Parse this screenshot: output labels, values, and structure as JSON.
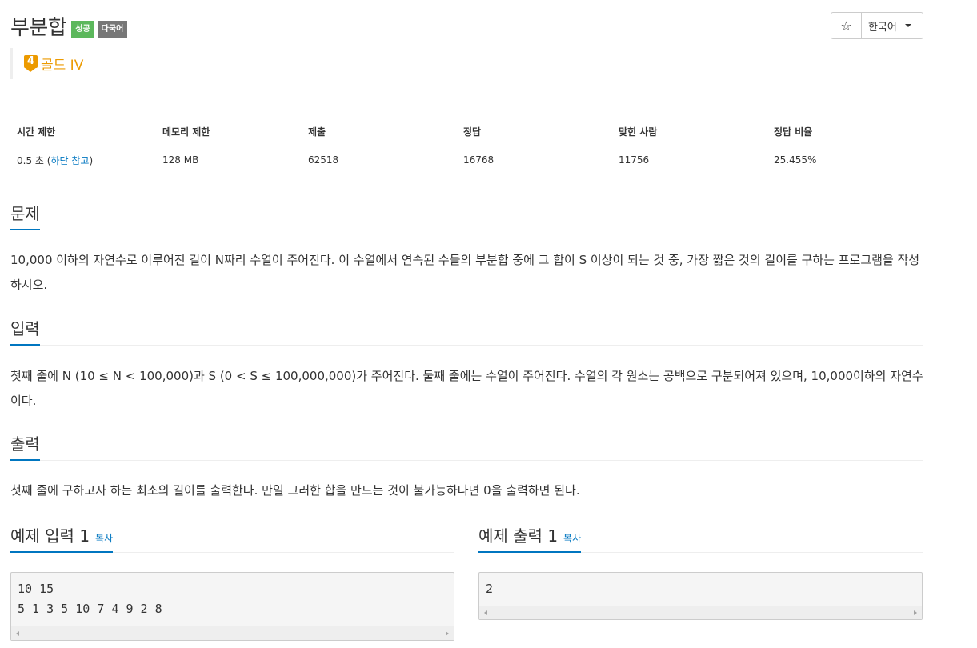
{
  "problem": {
    "title": "부분합",
    "badges": {
      "success": "성공",
      "multilang": "다국어"
    },
    "tier": {
      "number": "4",
      "label": "골드 IV",
      "color": "#ec9a00"
    }
  },
  "toolbar": {
    "star_icon": "☆",
    "language": "한국어"
  },
  "info_table": {
    "headers": [
      "시간 제한",
      "메모리 제한",
      "제출",
      "정답",
      "맞힌 사람",
      "정답 비율"
    ],
    "time_limit": "0.5 초",
    "time_note_open": " (",
    "time_note_link": "하단 참고",
    "time_note_close": ")",
    "memory_limit": "128 MB",
    "submissions": "62518",
    "accepted": "16768",
    "solvers": "11756",
    "ratio": "25.455%"
  },
  "sections": {
    "problem": {
      "title": "문제",
      "body": "10,000 이하의 자연수로 이루어진 길이 N짜리 수열이 주어진다. 이 수열에서 연속된 수들의 부분합 중에 그 합이 S 이상이 되는 것 중, 가장 짧은 것의 길이를 구하는 프로그램을 작성하시오."
    },
    "input": {
      "title": "입력",
      "body": "첫째 줄에 N (10 ≤ N < 100,000)과 S (0 < S ≤ 100,000,000)가 주어진다. 둘째 줄에는 수열이 주어진다. 수열의 각 원소는 공백으로 구분되어져 있으며, 10,000이하의 자연수이다."
    },
    "output": {
      "title": "출력",
      "body": "첫째 줄에 구하고자 하는 최소의 길이를 출력한다. 만일 그러한 합을 만드는 것이 불가능하다면 0을 출력하면 된다."
    }
  },
  "samples": {
    "copy_label": "복사",
    "input": {
      "title": "예제 입력 1",
      "content": "10 15\n5 1 3 5 10 7 4 9 2 8"
    },
    "output": {
      "title": "예제 출력 1",
      "content": "2"
    }
  },
  "colors": {
    "accent": "#0076c0",
    "success": "#5cb85c",
    "multilang": "#777777",
    "gold": "#ec9a00"
  }
}
